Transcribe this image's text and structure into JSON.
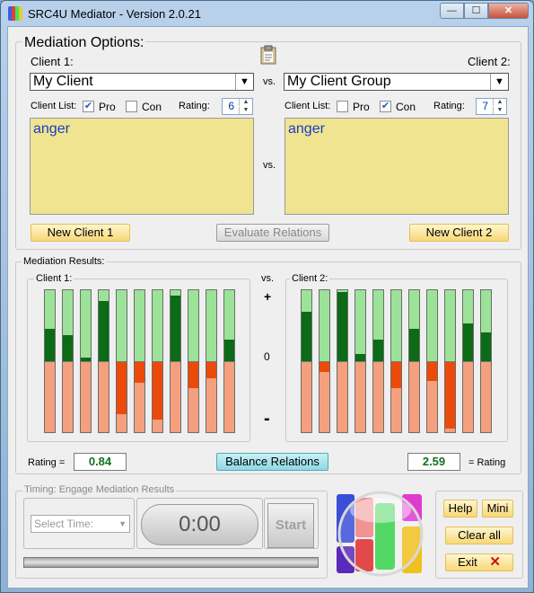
{
  "window": {
    "title": "SRC4U Mediator - Version 2.0.21",
    "min_glyph": "—",
    "max_glyph": "☐",
    "close_glyph": "✕"
  },
  "options": {
    "group_label": "Mediation Options:",
    "client1_label": "Client 1:",
    "client2_label": "Client 2:",
    "vs": "vs.",
    "client1_value": "My Client",
    "client2_value": "My Client Group",
    "client_list_label": "Client List:",
    "pro_label": "Pro",
    "con_label": "Con",
    "rating_label": "Rating:",
    "client1": {
      "pro_checked": true,
      "con_checked": false,
      "rating": "6",
      "text": "anger"
    },
    "client2": {
      "pro_checked": false,
      "con_checked": true,
      "rating": "7",
      "text": "anger"
    },
    "new_client1": "New Client 1",
    "new_client2": "New Client 2",
    "evaluate": "Evaluate Relations",
    "clipboard_icon": "clipboard-icon"
  },
  "results": {
    "group_label": "Mediation Results:",
    "client1_label": "Client 1:",
    "client2_label": "Client 2:",
    "vs": "vs.",
    "plus": "+",
    "zero": "0",
    "minus": "-",
    "client1_bars": [
      {
        "pos": 0.45,
        "neg": 0
      },
      {
        "pos": 0.37,
        "neg": 0
      },
      {
        "pos": 0.05,
        "neg": 0
      },
      {
        "pos": 0.85,
        "neg": 0
      },
      {
        "pos": 0,
        "neg": 0.75
      },
      {
        "pos": 0,
        "neg": 0.3
      },
      {
        "pos": 0,
        "neg": 0.82
      },
      {
        "pos": 0.93,
        "neg": 0
      },
      {
        "pos": 0,
        "neg": 0.38
      },
      {
        "pos": 0,
        "neg": 0.24
      },
      {
        "pos": 0.3,
        "neg": 0
      }
    ],
    "client2_bars": [
      {
        "pos": 0.7,
        "neg": 0
      },
      {
        "pos": 0,
        "neg": 0.15
      },
      {
        "pos": 0.97,
        "neg": 0
      },
      {
        "pos": 0.1,
        "neg": 0
      },
      {
        "pos": 0.3,
        "neg": 0
      },
      {
        "pos": 0,
        "neg": 0.38
      },
      {
        "pos": 0.45,
        "neg": 0
      },
      {
        "pos": 0,
        "neg": 0.28
      },
      {
        "pos": 0,
        "neg": 0.95
      },
      {
        "pos": 0.53,
        "neg": 0
      },
      {
        "pos": 0.4,
        "neg": 0
      }
    ],
    "rating_left_label": "Rating =",
    "rating_left_value": "0.84",
    "balance": "Balance Relations",
    "rating_right_value": "2.59",
    "rating_right_label": "= Rating",
    "colors": {
      "pos_bg": "#9ce399",
      "pos_fill": "#0c6b16",
      "neg_bg": "#f4a07e",
      "neg_fill": "#ec4a0a"
    }
  },
  "timing": {
    "group_label": "Timing: Engage Mediation Results",
    "select_placeholder": "Select Time:",
    "timer": "0:00",
    "start": "Start"
  },
  "side": {
    "help": "Help",
    "mini": "Mini",
    "clear_all": "Clear all",
    "exit": "Exit",
    "exit_glyph": "✕"
  }
}
